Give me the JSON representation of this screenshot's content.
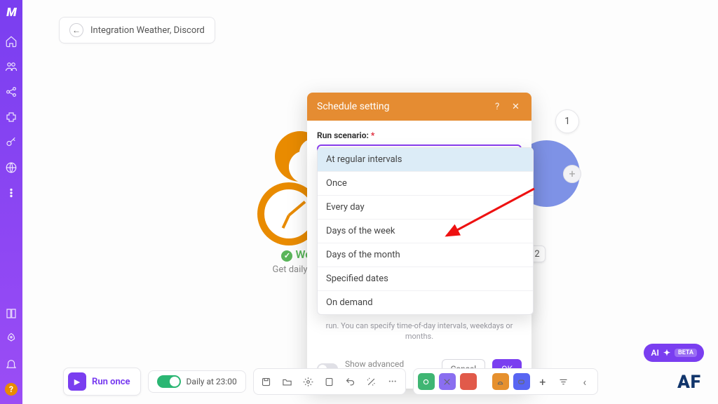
{
  "breadcrumb": {
    "label": "Integration Weather, Discord"
  },
  "module": {
    "title": "Wea",
    "subtitle": "Get daily wea"
  },
  "steps": {
    "one": "1",
    "two": "2"
  },
  "modal": {
    "title": "Schedule setting",
    "field_label": "Run scenario:",
    "selected": "At regular intervals",
    "options": [
      "At regular intervals",
      "Once",
      "Every day",
      "Days of the week",
      "Days of the month",
      "Specified dates",
      "On demand"
    ],
    "helper": "run. You can specify time-of-day intervals, weekdays or months.",
    "advanced_label": "Show advanced settings",
    "cancel": "Cancel",
    "ok": "OK"
  },
  "toolbar": {
    "run_label": "Run once",
    "schedule_text": "Daily at 23:00",
    "more": "···",
    "plus": "+",
    "chevron": "‹"
  },
  "ai": {
    "label": "AI",
    "beta": "BETA"
  },
  "brand": "AF",
  "help_glyph": "?"
}
